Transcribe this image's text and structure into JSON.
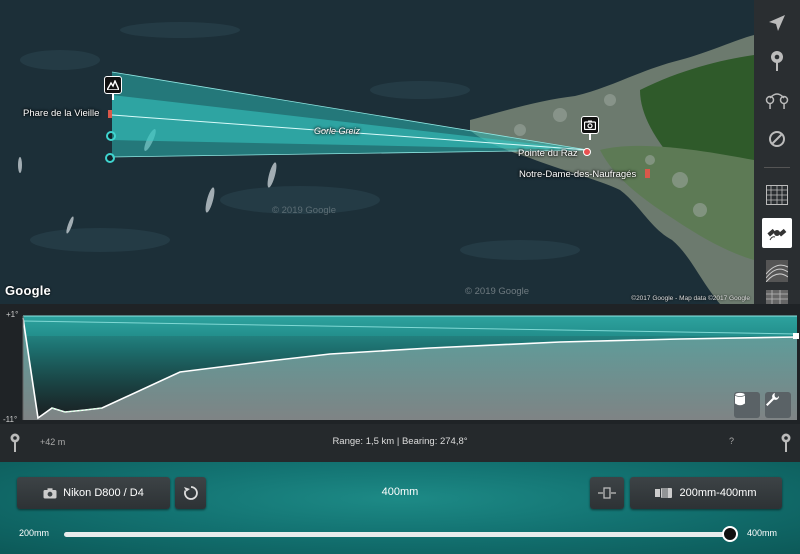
{
  "map": {
    "labels": {
      "phare": "Phare de la Vieille",
      "gorle": "Gorle Greiz",
      "pointe": "Pointe du Raz",
      "notre_dame": "Notre-Dame-des-Naufragés"
    },
    "google_logo": "Google",
    "attribution": "©2017 Google - Map data ©2017 Google",
    "watermarks": [
      "© 2019 Google",
      "© 2019 Google"
    ],
    "subject_icon": "mountain-icon",
    "camera_icon": "camera-icon"
  },
  "toolbar": {
    "tools": [
      "navigation-arrow-icon",
      "pin-icon",
      "double-pin-icon",
      "block-icon",
      "grid-layer-icon",
      "satellite-icon",
      "terrain-layer-icon",
      "map-layer-icon"
    ]
  },
  "profile": {
    "y_max_label": "+1°",
    "y_min_label": "-11°",
    "buttons": [
      "cylinder-icon",
      "wrench-icon"
    ]
  },
  "infobar": {
    "elevation": "+42 m",
    "range_bearing": "Range: 1,5 km | Bearing: 274,8°",
    "help": "?"
  },
  "controls": {
    "camera_label": "Nikon D800 / D4",
    "focal_length": "400mm",
    "lens_label": "200mm-400mm",
    "slider_min": "200mm",
    "slider_max": "400mm",
    "slider_value": 400,
    "slider_range": [
      200,
      400
    ]
  },
  "colors": {
    "accent": "#1d8a86",
    "cone_fill": "#2bb5b0",
    "panel_dark": "#2d3235"
  }
}
